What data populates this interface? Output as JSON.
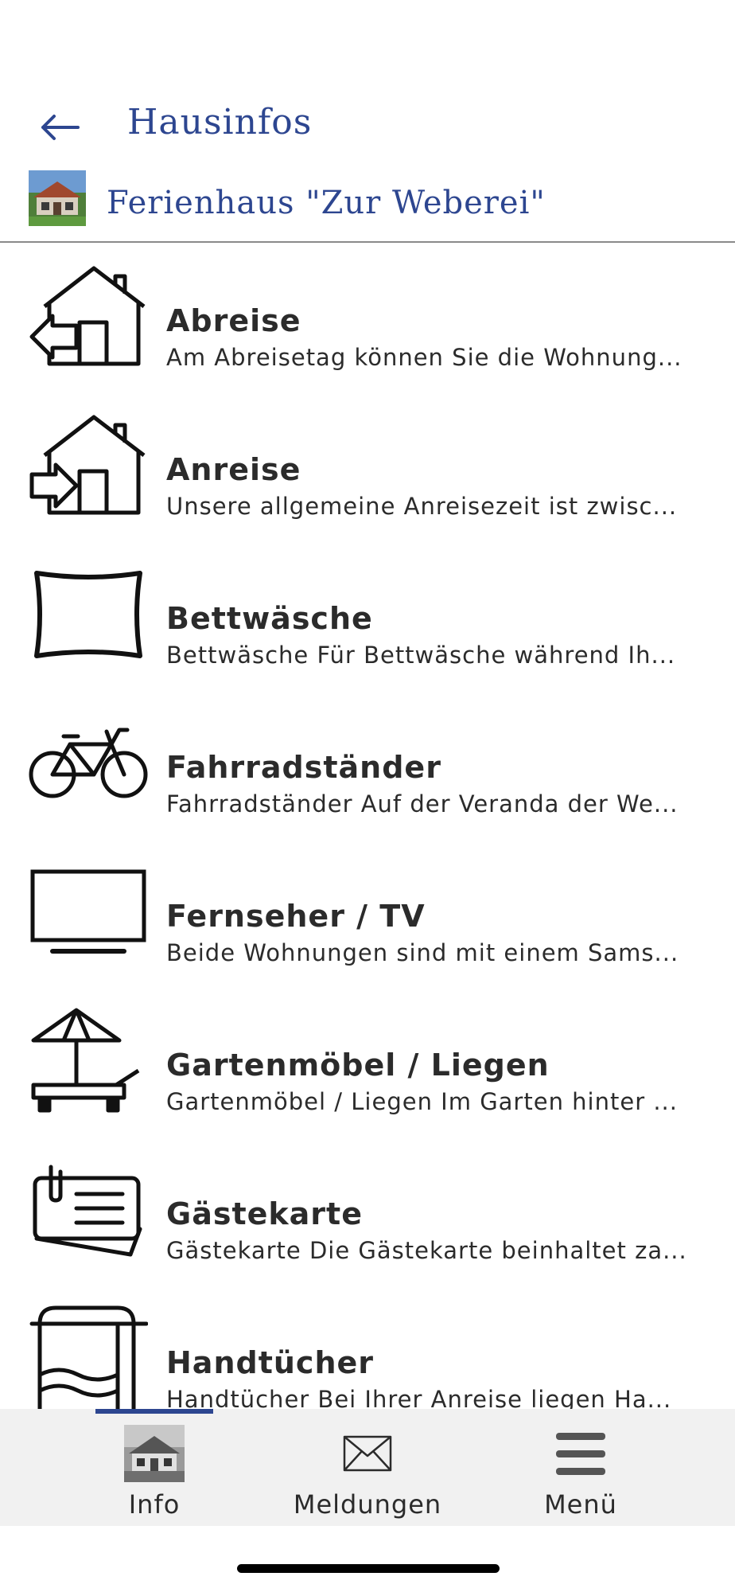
{
  "header": {
    "title": "Hausinfos",
    "house_name": "Ferienhaus \"Zur Weberei\"",
    "back_icon": "arrow-left-icon"
  },
  "items": [
    {
      "icon": "house-exit-icon",
      "title": "Abreise",
      "desc": "Am Abreisetag können Sie die Wohnung..."
    },
    {
      "icon": "house-enter-icon",
      "title": "Anreise",
      "desc": "Unsere allgemeine Anreisezeit ist zwisc..."
    },
    {
      "icon": "pillow-icon",
      "title": "Bettwäsche",
      "desc": "Bettwäsche Für Bettwäsche während Ih..."
    },
    {
      "icon": "bicycle-icon",
      "title": "Fahrradständer",
      "desc": "Fahrradständer Auf der Veranda der We..."
    },
    {
      "icon": "tv-icon",
      "title": "Fernseher / TV",
      "desc": "Beide Wohnungen sind mit einem Sams..."
    },
    {
      "icon": "parasol-lounger-icon",
      "title": "Gartenmöbel / Liegen",
      "desc": "Gartenmöbel / Liegen Im Garten hinter ..."
    },
    {
      "icon": "guest-card-icon",
      "title": "Gästekarte",
      "desc": "Gästekarte Die Gästekarte beinhaltet za..."
    },
    {
      "icon": "towel-icon",
      "title": "Handtücher",
      "desc": "Handtücher Bei Ihrer Anreise liegen Ha..."
    }
  ],
  "tabbar": {
    "tabs": [
      {
        "label": "Info",
        "icon": "house-photo-icon",
        "active": true
      },
      {
        "label": "Meldungen",
        "icon": "envelope-icon",
        "active": false
      },
      {
        "label": "Menü",
        "icon": "hamburger-menu-icon",
        "active": false
      }
    ]
  },
  "colors": {
    "accent": "#2d4690",
    "text": "#2b2b2b",
    "tabbar_bg": "#f1f1f1",
    "divider": "#8a8a8a"
  }
}
